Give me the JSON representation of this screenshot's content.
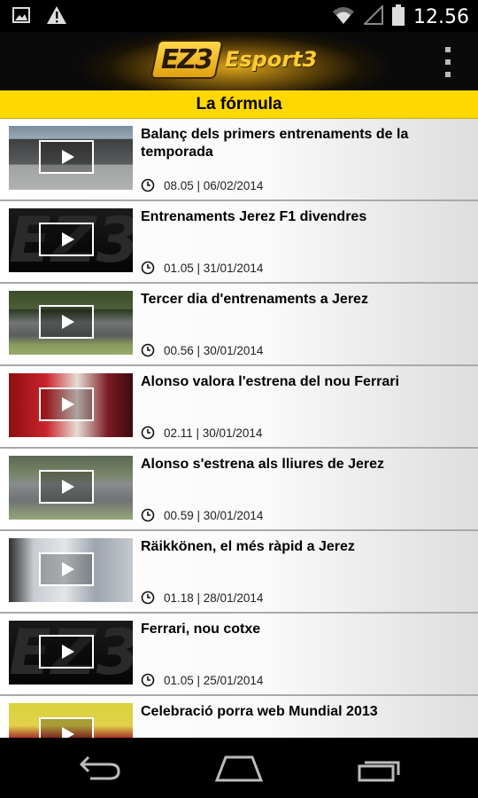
{
  "status_bar": {
    "time": "12.56",
    "icons": [
      "image-icon",
      "warning-icon",
      "wifi-icon",
      "signal-icon",
      "battery-icon"
    ]
  },
  "app_bar": {
    "logo_badge": "EZ3",
    "logo_text": "Esport3",
    "menu_icon": "overflow-menu-icon"
  },
  "section": {
    "title": "La fórmula"
  },
  "videos": [
    {
      "title": "Balanç dels primers entrenaments de la temporada",
      "meta": "08.05 | 06/02/2014",
      "thumb": "t-track"
    },
    {
      "title": "Entrenaments Jerez F1 divendres",
      "meta": "01.05 | 31/01/2014",
      "thumb": "t-dark"
    },
    {
      "title": "Tercer dia d'entrenaments a Jerez",
      "meta": "00.56 | 30/01/2014",
      "thumb": "t-green"
    },
    {
      "title": "Alonso valora l'estrena del nou Ferrari",
      "meta": "02.11 | 30/01/2014",
      "thumb": "t-red"
    },
    {
      "title": "Alonso s'estrena als lliures de Jerez",
      "meta": "00.59 | 30/01/2014",
      "thumb": "t-track2"
    },
    {
      "title": "Räikkönen, el més ràpid a Jerez",
      "meta": "01.18 | 28/01/2014",
      "thumb": "t-paddock"
    },
    {
      "title": "Ferrari, nou cotxe",
      "meta": "01.05 | 25/01/2014",
      "thumb": "t-dark"
    },
    {
      "title": "Celebració porra web Mundial 2013",
      "meta": "",
      "thumb": "t-party"
    }
  ],
  "nav_bar": {
    "icons": [
      "back-icon",
      "home-icon",
      "recent-apps-icon"
    ]
  },
  "colors": {
    "accent": "#ffd800",
    "status_bar": "#000000",
    "logo_gold": "#ffcc33"
  }
}
